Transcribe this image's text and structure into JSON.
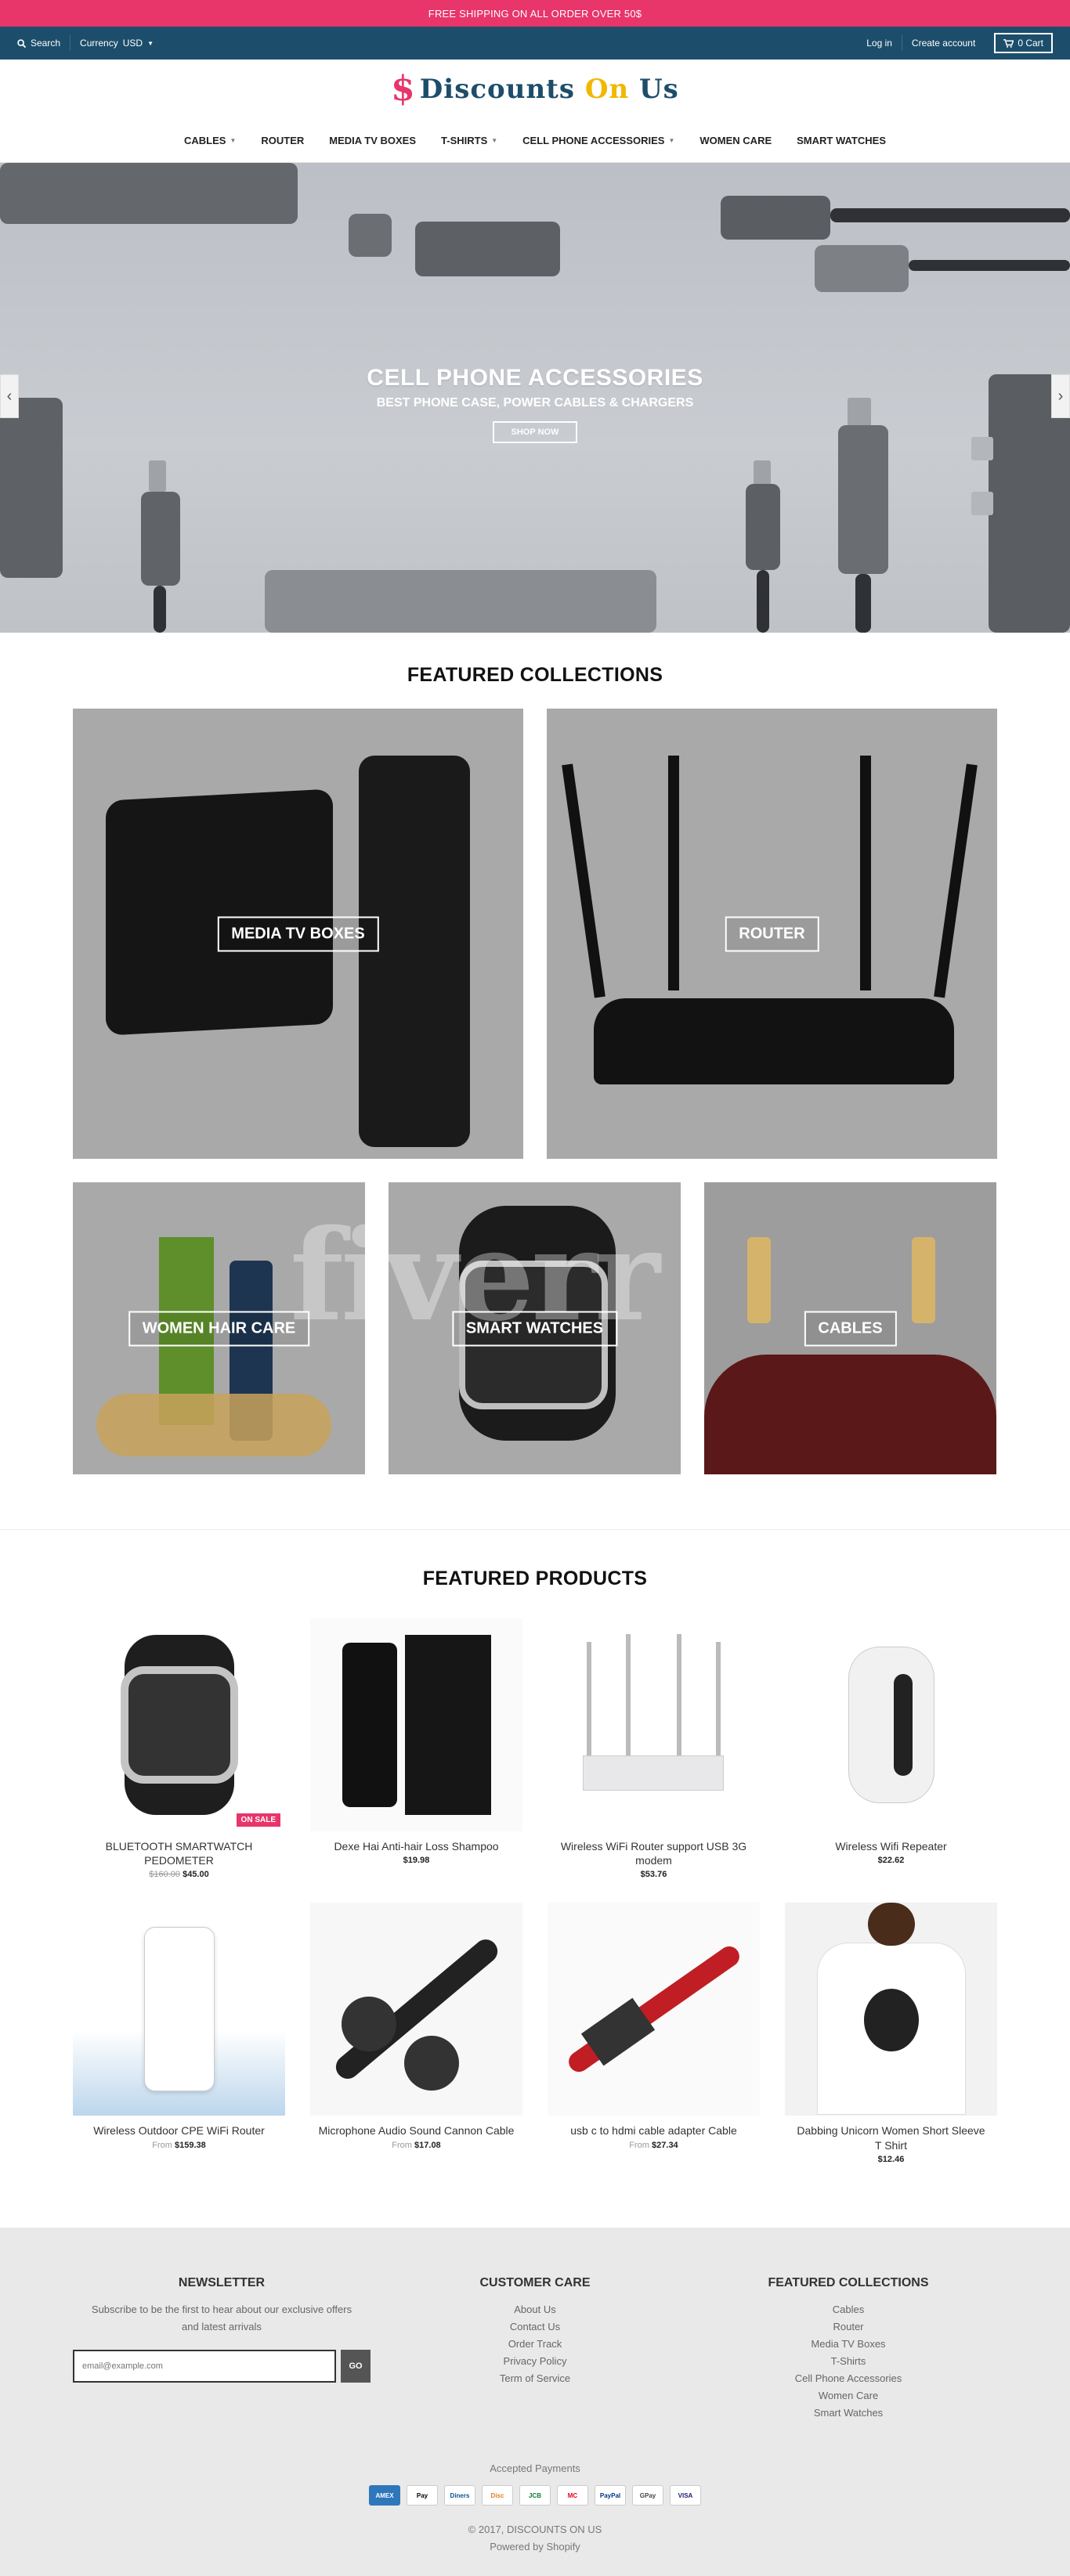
{
  "announcement": "FREE SHIPPING ON ALL ORDER OVER 50$",
  "topbar": {
    "search": "Search",
    "currency_label": "Currency",
    "currency_value": "USD",
    "login": "Log in",
    "create_account": "Create account",
    "cart": "0 Cart"
  },
  "brand": {
    "mark": "$",
    "text_a": "Discounts ",
    "text_on": "On",
    "text_b": " Us"
  },
  "nav": [
    {
      "label": "CABLES",
      "dropdown": true
    },
    {
      "label": "ROUTER",
      "dropdown": false
    },
    {
      "label": "MEDIA TV BOXES",
      "dropdown": false
    },
    {
      "label": "T-SHIRTS",
      "dropdown": true
    },
    {
      "label": "CELL PHONE ACCESSORIES",
      "dropdown": true
    },
    {
      "label": "WOMEN CARE",
      "dropdown": false
    },
    {
      "label": "SMART WATCHES",
      "dropdown": false
    }
  ],
  "hero": {
    "title": "CELL PHONE ACCESSORIES",
    "subtitle": "BEST PHONE CASE, POWER CABLES & CHARGERS",
    "button": "SHOP NOW",
    "prev": "‹",
    "next": "›"
  },
  "collections": {
    "title": "FEATURED COLLECTIONS",
    "items": [
      "MEDIA TV BOXES",
      "ROUTER",
      "WOMEN HAIR CARE",
      "SMART WATCHES",
      "CABLES"
    ]
  },
  "products": {
    "title": "FEATURED PRODUCTS",
    "items": [
      {
        "name": "BLUETOOTH SMARTWATCH PEDOMETER",
        "price": "$45.00",
        "old": "$160.00",
        "from": "",
        "badge": "ON SALE"
      },
      {
        "name": "Dexe Hai Anti-hair Loss Shampoo",
        "price": "$19.98",
        "old": "",
        "from": "",
        "badge": ""
      },
      {
        "name": "Wireless WiFi Router support USB 3G modem",
        "price": "$53.76",
        "old": "",
        "from": "",
        "badge": ""
      },
      {
        "name": "Wireless Wifi Repeater",
        "price": "$22.62",
        "old": "",
        "from": "",
        "badge": ""
      },
      {
        "name": "Wireless Outdoor CPE WiFi Router",
        "price": "$159.38",
        "old": "",
        "from": "From",
        "badge": ""
      },
      {
        "name": "Microphone Audio Sound Cannon Cable",
        "price": "$17.08",
        "old": "",
        "from": "From",
        "badge": ""
      },
      {
        "name": "usb c to hdmi cable adapter Cable",
        "price": "$27.34",
        "old": "",
        "from": "From",
        "badge": ""
      },
      {
        "name": "Dabbing Unicorn Women Short Sleeve T Shirt",
        "price": "$12.46",
        "old": "",
        "from": "",
        "badge": ""
      }
    ]
  },
  "footer": {
    "newsletter_title": "NEWSLETTER",
    "newsletter_text": "Subscribe to be the first to hear about our exclusive offers and latest arrivals",
    "email_placeholder": "email@example.com",
    "go": "GO",
    "care_title": "CUSTOMER CARE",
    "care_links": [
      "About Us",
      "Contact Us",
      "Order Track",
      "Privacy Policy",
      "Term of Service"
    ],
    "fc_title": "FEATURED COLLECTIONS",
    "fc_links": [
      "Cables",
      "Router",
      "Media TV Boxes",
      "T-Shirts",
      "Cell Phone Accessories",
      "Women Care",
      "Smart Watches"
    ],
    "payments_label": "Accepted Payments",
    "payments": [
      "AMEX",
      "Pay",
      "Diners",
      "Disc",
      "JCB",
      "MC",
      "PayPal",
      "GPay",
      "VISA"
    ],
    "copyright": "© 2017, DISCOUNTS ON US",
    "powered": "Powered by Shopify"
  },
  "watermark": "fiverr",
  "colors": {
    "accent": "#e8356a",
    "topbar": "#1c4e6b",
    "footer": "#e9e9e9"
  }
}
